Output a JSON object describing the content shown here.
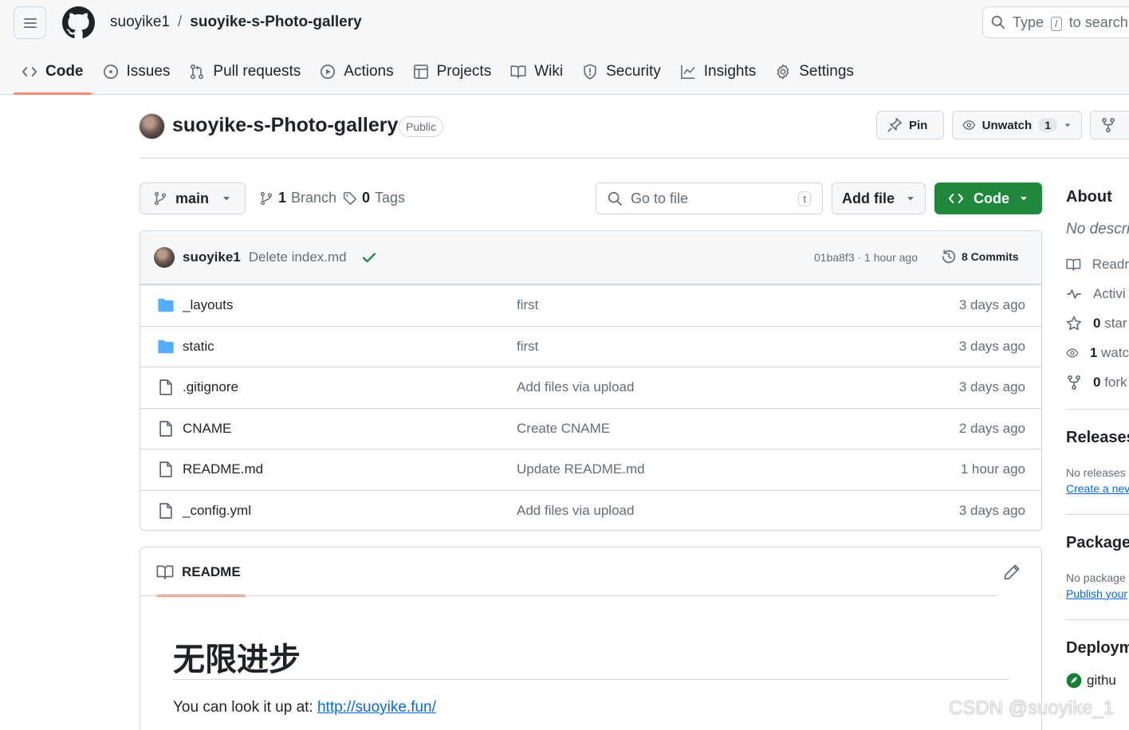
{
  "header": {
    "owner": "suoyike1",
    "separator": "/",
    "repo": "suoyike-s-Photo-gallery",
    "search_prefix": "Type",
    "search_key": "/",
    "search_suffix": "to search"
  },
  "tabs": [
    {
      "label": "Code",
      "icon": "code-icon",
      "active": true
    },
    {
      "label": "Issues",
      "icon": "issue-icon"
    },
    {
      "label": "Pull requests",
      "icon": "pull-request-icon"
    },
    {
      "label": "Actions",
      "icon": "play-icon"
    },
    {
      "label": "Projects",
      "icon": "table-icon"
    },
    {
      "label": "Wiki",
      "icon": "book-icon"
    },
    {
      "label": "Security",
      "icon": "shield-icon"
    },
    {
      "label": "Insights",
      "icon": "graph-icon"
    },
    {
      "label": "Settings",
      "icon": "gear-icon"
    }
  ],
  "repo_header": {
    "title": "suoyike-s-Photo-gallery",
    "visibility": "Public",
    "pin_label": "Pin",
    "unwatch_label": "Unwatch",
    "watch_count": "1"
  },
  "file_nav": {
    "branch": "main",
    "branch_count": "1",
    "branch_label": "Branch",
    "tag_count": "0",
    "tag_label": "Tags",
    "goto_placeholder": "Go to file",
    "goto_key": "t",
    "add_file_label": "Add file",
    "code_label": "Code"
  },
  "latest_commit": {
    "author": "suoyike1",
    "message": "Delete index.md",
    "status": "success",
    "hash_time": "01ba8f3 · 1 hour ago",
    "commits_label": "8 Commits"
  },
  "files": [
    {
      "name": "_layouts",
      "type": "folder",
      "message": "first",
      "date": "3 days ago"
    },
    {
      "name": "static",
      "type": "folder",
      "message": "first",
      "date": "3 days ago"
    },
    {
      "name": ".gitignore",
      "type": "file",
      "message": "Add files via upload",
      "date": "3 days ago"
    },
    {
      "name": "CNAME",
      "type": "file",
      "message": "Create CNAME",
      "date": "2 days ago"
    },
    {
      "name": "README.md",
      "type": "file",
      "message": "Update README.md",
      "date": "1 hour ago"
    },
    {
      "name": "_config.yml",
      "type": "file",
      "message": "Add files via upload",
      "date": "3 days ago"
    }
  ],
  "readme": {
    "tab_label": "README",
    "heading": "无限进步",
    "text": "You can look it up at: ",
    "link": "http://suoyike.fun/"
  },
  "sidebar": {
    "about_title": "About",
    "description": "No descri",
    "items": [
      {
        "icon": "book-icon",
        "label": "Readr"
      },
      {
        "icon": "pulse-icon",
        "label": "Activi"
      },
      {
        "icon": "star-icon",
        "count": "0",
        "label": "star"
      },
      {
        "icon": "eye-icon",
        "count": "1",
        "label": "watc"
      },
      {
        "icon": "fork-icon",
        "count": "0",
        "label": "fork"
      }
    ],
    "releases_title": "Releases",
    "releases_text": "No releases",
    "releases_link": "Create a nev",
    "packages_title": "Packages",
    "packages_text": "No package",
    "packages_link": "Publish your",
    "deployments_title": "Deploym",
    "deployment_item": "githu"
  },
  "watermark": "CSDN @suoyike_1",
  "colors": {
    "accent_underline": "#fd8c73",
    "code_button": "#1f883d",
    "link": "#0969da",
    "folder": "#54aeff",
    "check": "#1a7f37"
  }
}
